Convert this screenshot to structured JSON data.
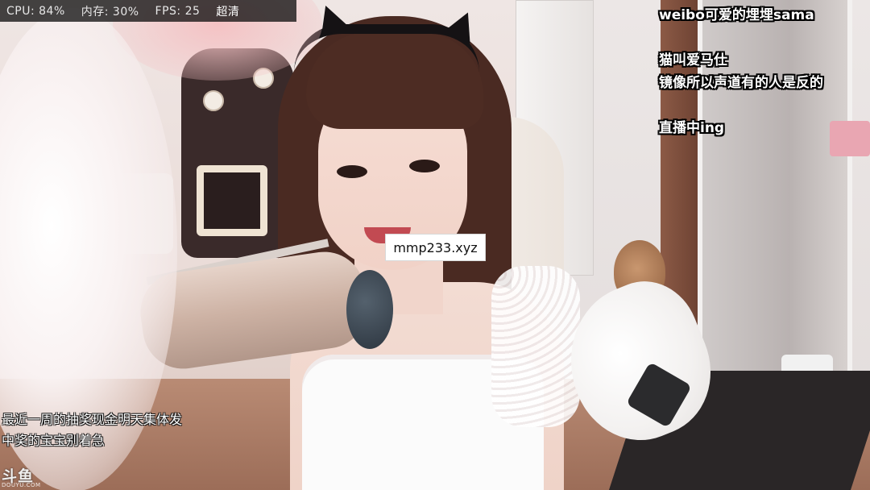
{
  "stats": {
    "cpu": "CPU: 84%",
    "memory": "内存: 30%",
    "fps": "FPS: 25",
    "quality": "超清"
  },
  "watermark_text": "mmp233.xyz",
  "captions": {
    "weibo": "weibo可爱的埋埋sama",
    "line1": "猫叫爱马仕",
    "line2": "镜像所以声道有的人是反的",
    "live": "直播中ing"
  },
  "bottom_captions": {
    "line1": "最近一周的抽奖现金明天集体发",
    "line2": "中奖的宝宝别着急"
  },
  "logo": {
    "cn": "斗鱼",
    "en": "DOUYU.COM"
  },
  "colors": {
    "stats_bg": "#121212",
    "caption_text": "#ffffff",
    "caption_outline": "#000000"
  }
}
